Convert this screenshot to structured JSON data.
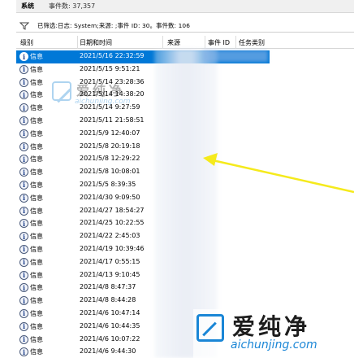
{
  "titlebar": {
    "log_name": "系统",
    "event_count": "事件数: 37,357"
  },
  "filter": {
    "text": "已筛选:日志: System;来源: ;事件 ID: 30。事件数: 106"
  },
  "columns": {
    "level": "级别",
    "datetime": "日期和时间",
    "source": "来源",
    "event_id": "事件 ID",
    "task_category": "任务类别"
  },
  "rows": [
    {
      "level": "信息",
      "datetime": "2021/5/16 22:32:59",
      "selected": true
    },
    {
      "level": "信息",
      "datetime": "2021/5/15 9:51:21"
    },
    {
      "level": "信息",
      "datetime": "2021/5/14 23:28:36"
    },
    {
      "level": "信息",
      "datetime": "2021/5/14 14:38:20"
    },
    {
      "level": "信息",
      "datetime": "2021/5/14 9:27:59"
    },
    {
      "level": "信息",
      "datetime": "2021/5/11 21:58:51"
    },
    {
      "level": "信息",
      "datetime": "2021/5/9 12:40:07"
    },
    {
      "level": "信息",
      "datetime": "2021/5/8 20:19:18"
    },
    {
      "level": "信息",
      "datetime": "2021/5/8 12:29:22"
    },
    {
      "level": "信息",
      "datetime": "2021/5/8 10:08:01"
    },
    {
      "level": "信息",
      "datetime": "2021/5/5 8:39:35"
    },
    {
      "level": "信息",
      "datetime": "2021/4/30 9:09:50"
    },
    {
      "level": "信息",
      "datetime": "2021/4/27 18:54:27"
    },
    {
      "level": "信息",
      "datetime": "2021/4/25 10:22:55"
    },
    {
      "level": "信息",
      "datetime": "2021/4/22 2:45:03"
    },
    {
      "level": "信息",
      "datetime": "2021/4/19 10:39:46"
    },
    {
      "level": "信息",
      "datetime": "2021/4/17 0:55:15"
    },
    {
      "level": "信息",
      "datetime": "2021/4/13 9:10:45"
    },
    {
      "level": "信息",
      "datetime": "2021/4/8 8:47:37"
    },
    {
      "level": "信息",
      "datetime": "2021/4/8 8:44:28"
    },
    {
      "level": "信息",
      "datetime": "2021/4/6 10:47:14"
    },
    {
      "level": "信息",
      "datetime": "2021/4/6 10:44:35"
    },
    {
      "level": "信息",
      "datetime": "2021/4/6 10:07:22"
    },
    {
      "level": "信息",
      "datetime": "2021/4/6 9:44:30"
    }
  ],
  "icons": {
    "filter": "filter-icon",
    "info": "info-icon"
  },
  "colors": {
    "selection": "#0078d7",
    "arrow": "#f5ea1c",
    "watermark_blue": "#1a86d6"
  },
  "watermark": {
    "brand": "爱纯净",
    "url": "aichunjing.com"
  }
}
